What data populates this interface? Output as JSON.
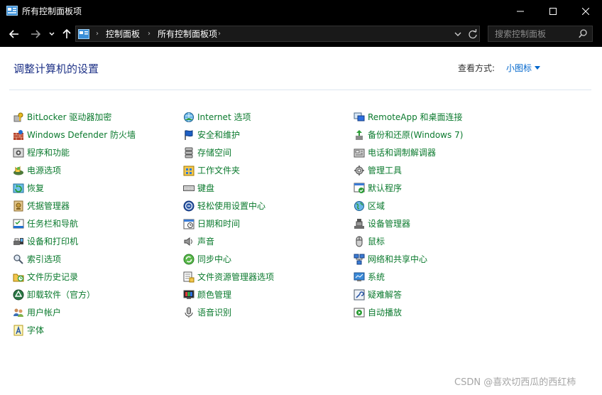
{
  "window": {
    "title": "所有控制面板项",
    "controls": {
      "minimize": "minimize",
      "maximize": "maximize",
      "close": "close"
    }
  },
  "navbar": {
    "address": {
      "breadcrumbs": [
        "控制面板",
        "所有控制面板项"
      ]
    },
    "search": {
      "placeholder": "搜索控制面板"
    }
  },
  "main": {
    "heading": "调整计算机的设置",
    "view_by_label": "查看方式:",
    "view_by_value": "小图标"
  },
  "items": {
    "col1": [
      {
        "label": "BitLocker 驱动器加密",
        "icon": "key-drive-icon"
      },
      {
        "label": "Windows Defender 防火墙",
        "icon": "firewall-icon"
      },
      {
        "label": "程序和功能",
        "icon": "programs-icon"
      },
      {
        "label": "电源选项",
        "icon": "power-icon"
      },
      {
        "label": "恢复",
        "icon": "recovery-icon"
      },
      {
        "label": "凭据管理器",
        "icon": "credential-icon"
      },
      {
        "label": "任务栏和导航",
        "icon": "taskbar-icon"
      },
      {
        "label": "设备和打印机",
        "icon": "printer-icon"
      },
      {
        "label": "索引选项",
        "icon": "indexing-icon"
      },
      {
        "label": "文件历史记录",
        "icon": "file-history-icon"
      },
      {
        "label": "卸载软件（官方）",
        "icon": "uninstall-icon"
      },
      {
        "label": "用户帐户",
        "icon": "users-icon"
      },
      {
        "label": "字体",
        "icon": "fonts-icon"
      }
    ],
    "col2": [
      {
        "label": "Internet 选项",
        "icon": "internet-icon"
      },
      {
        "label": "安全和维护",
        "icon": "flag-icon"
      },
      {
        "label": "存储空间",
        "icon": "storage-icon"
      },
      {
        "label": "工作文件夹",
        "icon": "work-folder-icon"
      },
      {
        "label": "键盘",
        "icon": "keyboard-icon"
      },
      {
        "label": "轻松使用设置中心",
        "icon": "ease-of-access-icon"
      },
      {
        "label": "日期和时间",
        "icon": "calendar-icon"
      },
      {
        "label": "声音",
        "icon": "speaker-icon"
      },
      {
        "label": "同步中心",
        "icon": "sync-icon"
      },
      {
        "label": "文件资源管理器选项",
        "icon": "folder-options-icon"
      },
      {
        "label": "颜色管理",
        "icon": "color-icon"
      },
      {
        "label": "语音识别",
        "icon": "microphone-icon"
      }
    ],
    "col3": [
      {
        "label": "RemoteApp 和桌面连接",
        "icon": "remote-icon"
      },
      {
        "label": "备份和还原(Windows 7)",
        "icon": "backup-icon"
      },
      {
        "label": "电话和调制解调器",
        "icon": "phone-icon"
      },
      {
        "label": "管理工具",
        "icon": "tools-icon"
      },
      {
        "label": "默认程序",
        "icon": "default-programs-icon"
      },
      {
        "label": "区域",
        "icon": "region-icon"
      },
      {
        "label": "设备管理器",
        "icon": "device-manager-icon"
      },
      {
        "label": "鼠标",
        "icon": "mouse-icon"
      },
      {
        "label": "网络和共享中心",
        "icon": "network-icon"
      },
      {
        "label": "系统",
        "icon": "system-icon"
      },
      {
        "label": "疑难解答",
        "icon": "troubleshoot-icon"
      },
      {
        "label": "自动播放",
        "icon": "autoplay-icon"
      }
    ]
  },
  "watermark": "CSDN @喜欢切西瓜的西红柿",
  "colors": {
    "titlebar_bg": "#000000",
    "heading": "#1e3287",
    "link_green": "#0b7a2e",
    "link_blue": "#0066cc"
  }
}
